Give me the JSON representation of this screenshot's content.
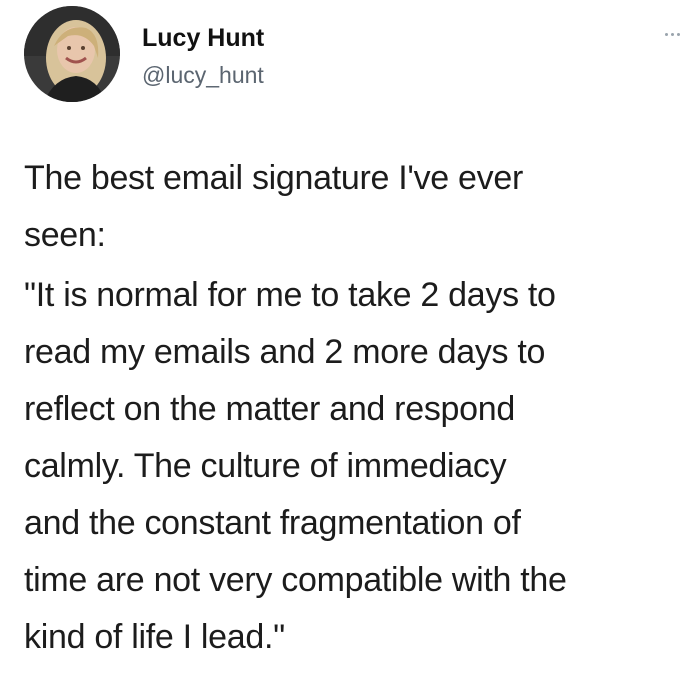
{
  "tweet": {
    "author": {
      "name": "Lucy Hunt",
      "handle": "@lucy_hunt",
      "avatar": "profile-photo"
    },
    "more_icon": "more-options-icon",
    "paragraphs": [
      "The best email signature I've ever\nseen:",
      "\"It is normal for me to take 2 days to\nread my emails and 2 more days to\nreflect on the matter and respond\ncalmly. The culture of immediacy\nand the constant fragmentation of\ntime are not very compatible with the\nkind of life I lead.\""
    ]
  }
}
